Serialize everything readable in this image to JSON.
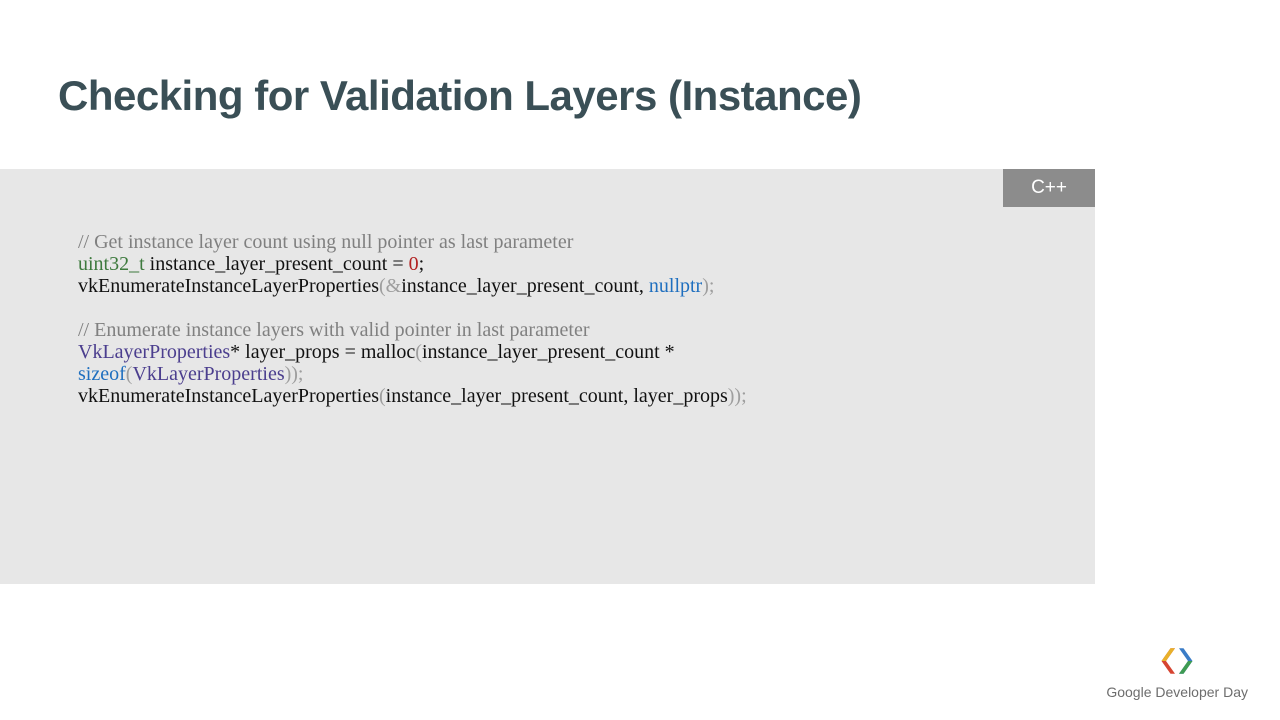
{
  "title": "Checking for Validation Layers (Instance)",
  "lang_badge": "C++",
  "code": {
    "l1_comment": "// Get instance layer count using null pointer as last parameter",
    "l2_type": "uint32_t",
    "l2_var": " instance_layer_present_count ",
    "l2_eq": "= ",
    "l2_zero": "0",
    "l2_semi": ";",
    "l3_fn": "vkEnumerateInstanceLayerProperties",
    "l3_p1": "(&",
    "l3_arg1": "instance_layer_present_count",
    "l3_comma": ", ",
    "l3_null": "nullptr",
    "l3_p2": ");",
    "l5_comment": "// Enumerate instance layers with valid pointer in last parameter",
    "l6_type": "VkLayerProperties",
    "l6_star": "* ",
    "l6_var": "layer_props ",
    "l6_eq": "= malloc",
    "l6_p1": "(",
    "l6_arg": "instance_layer_present_count *",
    "l7_sizeof": "sizeof",
    "l7_p1": "(",
    "l7_type": "VkLayerProperties",
    "l7_p2": "));",
    "l8_fn": "vkEnumerateInstanceLayerProperties",
    "l8_p1": "(",
    "l8_arg1": "instance_layer_present_count",
    "l8_comma": ", ",
    "l8_arg2": "layer_props",
    "l8_p2": "));"
  },
  "footer": {
    "brand1": "Google",
    "brand2": " Developer Day"
  }
}
